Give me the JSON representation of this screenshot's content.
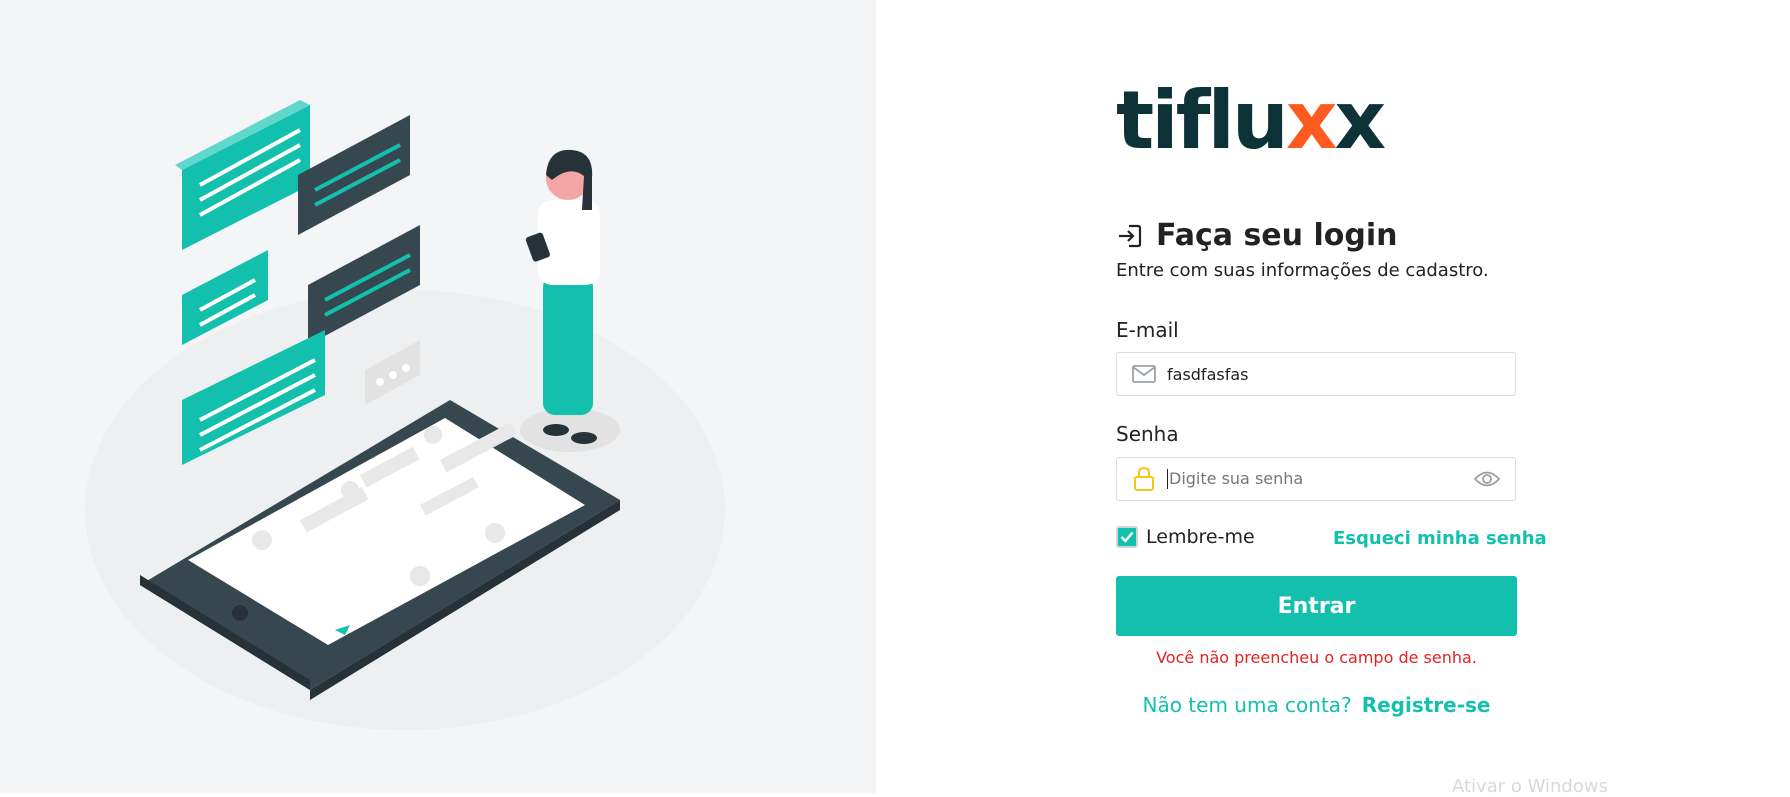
{
  "brand": {
    "logo_text_main": "tiflu",
    "logo_text_accent": "x",
    "logo_text_end": "x",
    "accent_color": "#ff5a1f",
    "primary_color": "#13c0ad",
    "dark_color": "#0d3238"
  },
  "login": {
    "icon": "login-arrow-icon",
    "title": "Faça seu login",
    "subtitle": "Entre com suas informações de cadastro."
  },
  "form": {
    "email_label": "E-mail",
    "email_value": "fasdfasfas",
    "email_icon": "envelope-icon",
    "password_label": "Senha",
    "password_placeholder": "Digite sua senha",
    "password_icon": "lock-icon",
    "password_toggle_icon": "eye-icon",
    "remember_label": "Lembre-me",
    "remember_checked": true,
    "forgot_label": "Esqueci minha senha",
    "submit_label": "Entrar",
    "error_message": "Você não preencheu o campo de senha."
  },
  "signup": {
    "question": "Não tem uma conta?",
    "link_label": "Registre-se"
  },
  "watermark": {
    "text": "Ativar o Windows"
  }
}
